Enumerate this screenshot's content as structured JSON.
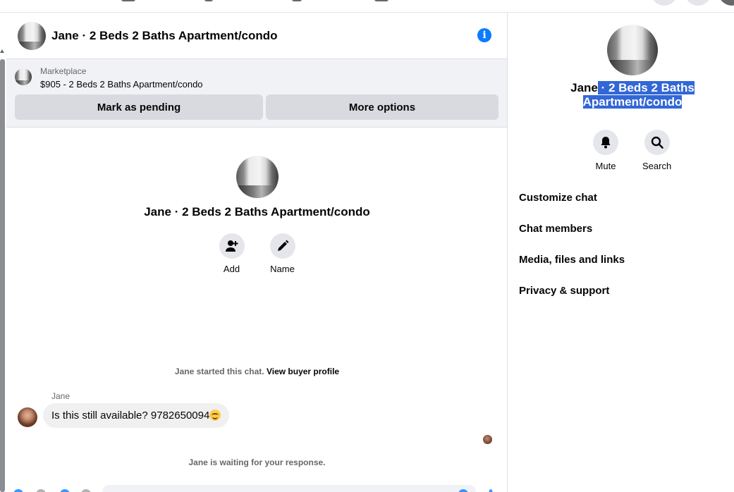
{
  "chat": {
    "title": "Jane · 2 Beds 2 Baths Apartment/condo",
    "info_icon": "info-icon",
    "marketplace": {
      "label": "Marketplace",
      "item": "$905 - 2 Beds 2 Baths Apartment/condo",
      "mark_pending_label": "Mark as pending",
      "more_options_label": "More options"
    },
    "intro": {
      "title": "Jane · 2 Beds 2 Baths Apartment/condo",
      "add_label": "Add",
      "name_label": "Name"
    },
    "started_text": "Jane started this chat.",
    "view_profile_link": "View buyer profile",
    "sender_name": "Jane",
    "message_text": "Is this still available? 9782650094",
    "message_emoji": "smiling-face-emoji",
    "waiting_text": "Jane is waiting for your response."
  },
  "panel": {
    "title_plain": "Jane",
    "title_selected_1": " · 2 Beds 2 Baths",
    "title_selected_2": "Apartment/condo",
    "mute_label": "Mute",
    "search_label": "Search",
    "menu": [
      {
        "label": "Customize chat"
      },
      {
        "label": "Chat members"
      },
      {
        "label": "Media, files and links"
      },
      {
        "label": "Privacy & support"
      }
    ]
  },
  "colors": {
    "accent": "#0a7cff",
    "selection": "#3367d6",
    "button_bg": "#d8dadf",
    "bubble_bg": "#f0f0f0",
    "marketplace_bg": "#f0f2f5"
  }
}
